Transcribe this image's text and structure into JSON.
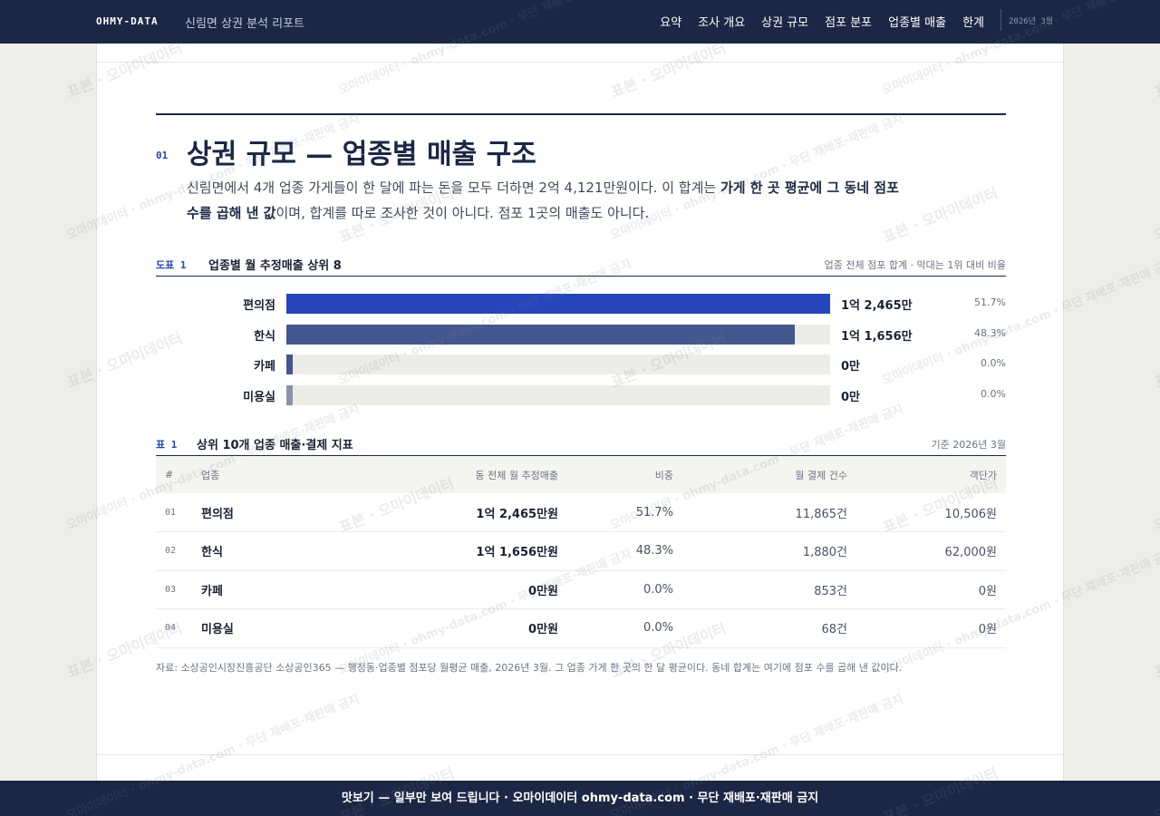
{
  "header": {
    "brand": "OHMY-DATA",
    "subtitle": "신림면 상권 분석 리포트",
    "nav": [
      "요약",
      "조사 개요",
      "상권 규모",
      "점포 분포",
      "업종별 매출",
      "한계"
    ],
    "date": "2026년 3월"
  },
  "section": {
    "number": "01",
    "title": "상권 규모 — 업종별 매출 구조",
    "lede_1": "신림면에서 4개 업종 가게들이 한 달에 파는 돈을 모두 더하면 2억 4,121만원이다. 이 합계는 ",
    "lede_bold": "가게 한 곳 평균에 그 동네 점포 수를 곱해 낸 값",
    "lede_2": "이며, 합계를 따로 조사한 것이 아니다. 점포 1곳의 매출도 아니다."
  },
  "figure": {
    "number": "도표 1",
    "title": "업종별 월 추정매출 상위 8",
    "note": "업종 전체 점포 합계 · 막대는 1위 대비 비율"
  },
  "chart_data": {
    "type": "bar",
    "orientation": "horizontal",
    "categories": [
      "편의점",
      "한식",
      "카페",
      "미용실"
    ],
    "values": [
      100,
      93.5,
      1.2,
      1.2
    ],
    "value_labels": [
      "1억 2,465만",
      "1억 1,656만",
      "0만",
      "0만"
    ],
    "share_labels": [
      "51.7%",
      "48.3%",
      "0.0%",
      "0.0%"
    ],
    "colors": [
      "#2446b8",
      "#44578f",
      "#44578f",
      "#8a93a8"
    ],
    "xlim": [
      0,
      100
    ]
  },
  "table": {
    "number": "표 1",
    "title": "상위 10개 업종 매출·결제 지표",
    "note": "기준 2026년 3월",
    "columns": [
      "#",
      "업종",
      "동 전체 월 추정매출",
      "비중",
      "월 결제 건수",
      "객단가"
    ],
    "rows": [
      [
        "01",
        "편의점",
        "1억 2,465만원",
        "51.7%",
        "11,865건",
        "10,506원"
      ],
      [
        "02",
        "한식",
        "1억 1,656만원",
        "48.3%",
        "1,880건",
        "62,000원"
      ],
      [
        "03",
        "카페",
        "0만원",
        "0.0%",
        "853건",
        "0원"
      ],
      [
        "04",
        "미용실",
        "0만원",
        "0.0%",
        "68건",
        "0원"
      ]
    ]
  },
  "source": "자료: 소상공인시장진흥공단 소상공인365 — 행정동·업종별 점포당 월평균 매출, 2026년 3월. 그 업종 가게 한 곳의 한 달 평균이다. 동네 합계는 여기에 점포 수를 곱해 낸 값이다.",
  "footer": "맛보기 — 일부만 보여 드립니다 · 오마이데이터 ohmy-data.com · 무단 재배포·재판매 금지",
  "watermark": [
    "표본 · 오마이데이터",
    "오마이데이터 · ohmy-data.com · 무단 재배포·재판매 금지"
  ]
}
